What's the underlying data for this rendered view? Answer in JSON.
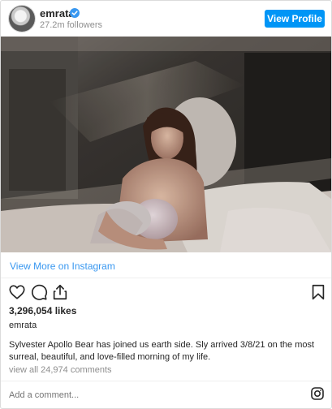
{
  "header": {
    "username": "emrata",
    "verified": true,
    "followers": "27.2m followers",
    "view_profile_label": "View Profile"
  },
  "photo": {
    "description_icon": "photo-image",
    "tone": "warm sepia hospital room"
  },
  "view_more_label": "View More on Instagram",
  "actions": {
    "icons": [
      "heart-icon",
      "comment-icon",
      "share-icon",
      "bookmark-icon"
    ]
  },
  "likes": "3,296,054 likes",
  "caption": {
    "username": "emrata",
    "text": "Sylvester Apollo Bear has joined us earth side. Sly arrived 3/8/21 on the most surreal, beautiful, and love-filled morning of my life."
  },
  "comments_link": "view all 24,974 comments",
  "comment_box": {
    "placeholder": "Add a comment..."
  },
  "colors": {
    "accent": "#0095f6",
    "link": "#3897f0",
    "muted": "#8e8e8e",
    "text": "#262626"
  }
}
